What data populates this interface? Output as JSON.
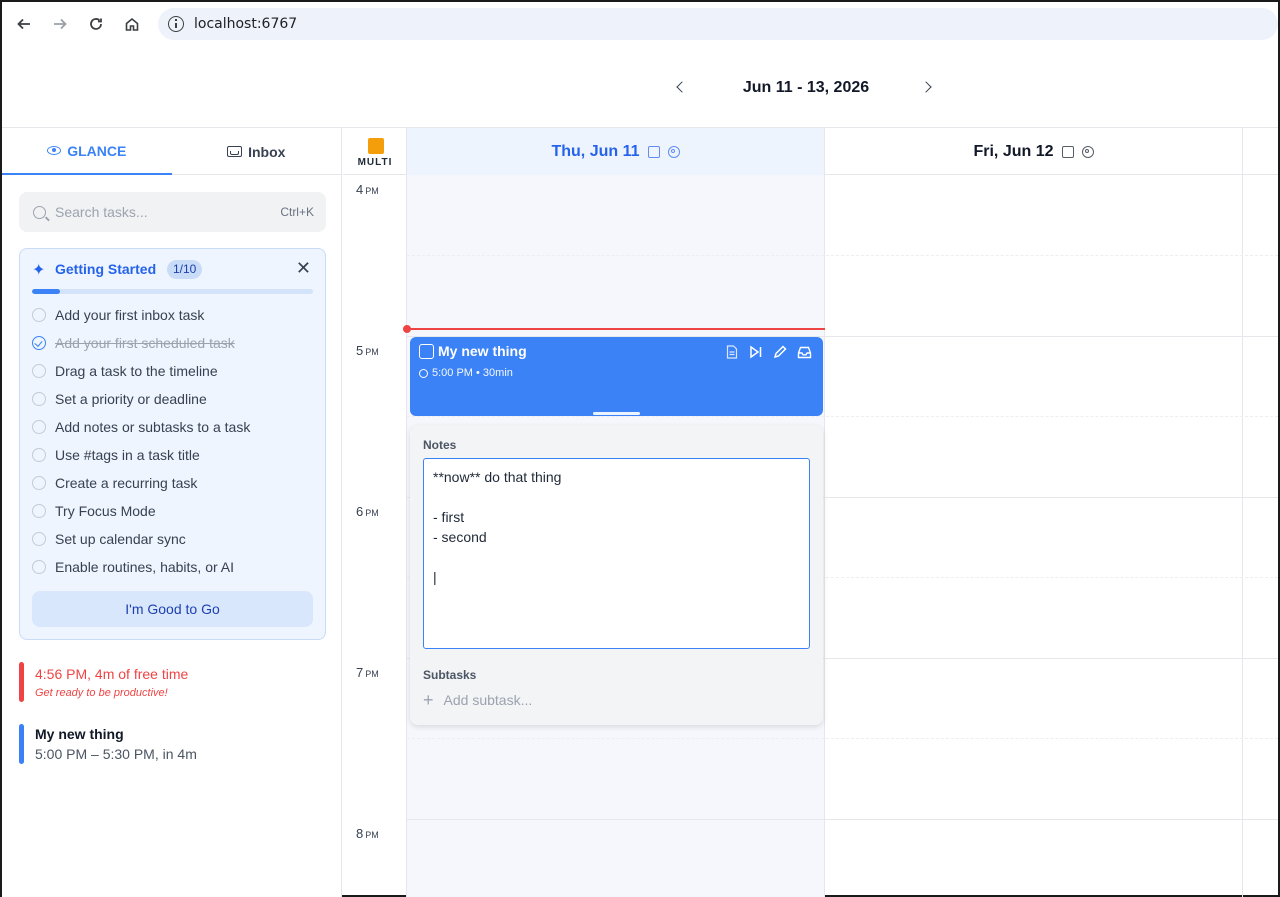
{
  "browser": {
    "url": "localhost:6767",
    "icons": {
      "back": "arrow-left-icon",
      "forward": "arrow-right-icon",
      "reload": "reload-icon",
      "home": "home-icon",
      "info": "info-icon"
    }
  },
  "header": {
    "date_range": "Jun 11 - 13, 2026"
  },
  "sidebar": {
    "tabs": [
      {
        "label": "GLANCE",
        "icon": "eye-icon",
        "active": true
      },
      {
        "label": "Inbox",
        "icon": "inbox-icon",
        "active": false
      }
    ],
    "search": {
      "placeholder": "Search tasks...",
      "shortcut": "Ctrl+K"
    },
    "getting_started": {
      "title": "Getting Started",
      "badge": "1/10",
      "progress_fraction": 0.1,
      "items": [
        {
          "label": "Add your first inbox task",
          "done": false
        },
        {
          "label": "Add your first scheduled task",
          "done": true
        },
        {
          "label": "Drag a task to the timeline",
          "done": false
        },
        {
          "label": "Set a priority or deadline",
          "done": false
        },
        {
          "label": "Add notes or subtasks to a task",
          "done": false
        },
        {
          "label": "Use #tags in a task title",
          "done": false
        },
        {
          "label": "Create a recurring task",
          "done": false
        },
        {
          "label": "Try Focus Mode",
          "done": false
        },
        {
          "label": "Set up calendar sync",
          "done": false
        },
        {
          "label": "Enable routines, habits, or AI",
          "done": false
        }
      ],
      "button": "I'm Good to Go"
    },
    "glance": [
      {
        "title": "4:56 PM, 4m of free time",
        "subtitle": "Get ready to be productive!",
        "color": "#ef4444"
      },
      {
        "title": "My new thing",
        "subtitle": "5:00 PM – 5:30 PM, in 4m",
        "color": "#3b82f6"
      }
    ]
  },
  "calendar": {
    "multi_label": "MULTI",
    "multi_color": "#f59e0b",
    "days": [
      {
        "label": "Thu, Jun 11",
        "today": true
      },
      {
        "label": "Fri, Jun 12",
        "today": false
      }
    ],
    "hours": [
      {
        "num": "4",
        "ampm": "PM"
      },
      {
        "num": "5",
        "ampm": "PM"
      },
      {
        "num": "6",
        "ampm": "PM"
      },
      {
        "num": "7",
        "ampm": "PM"
      },
      {
        "num": "8",
        "ampm": "PM"
      }
    ],
    "event": {
      "title": "My new thing",
      "time": "5:00 PM • 30min",
      "color": "#3b82f6"
    },
    "notes_panel": {
      "notes_label": "Notes",
      "notes_value": "**now** do that thing\n\n- first\n- second\n\n|",
      "subtasks_label": "Subtasks",
      "add_subtask_placeholder": "Add subtask..."
    }
  }
}
